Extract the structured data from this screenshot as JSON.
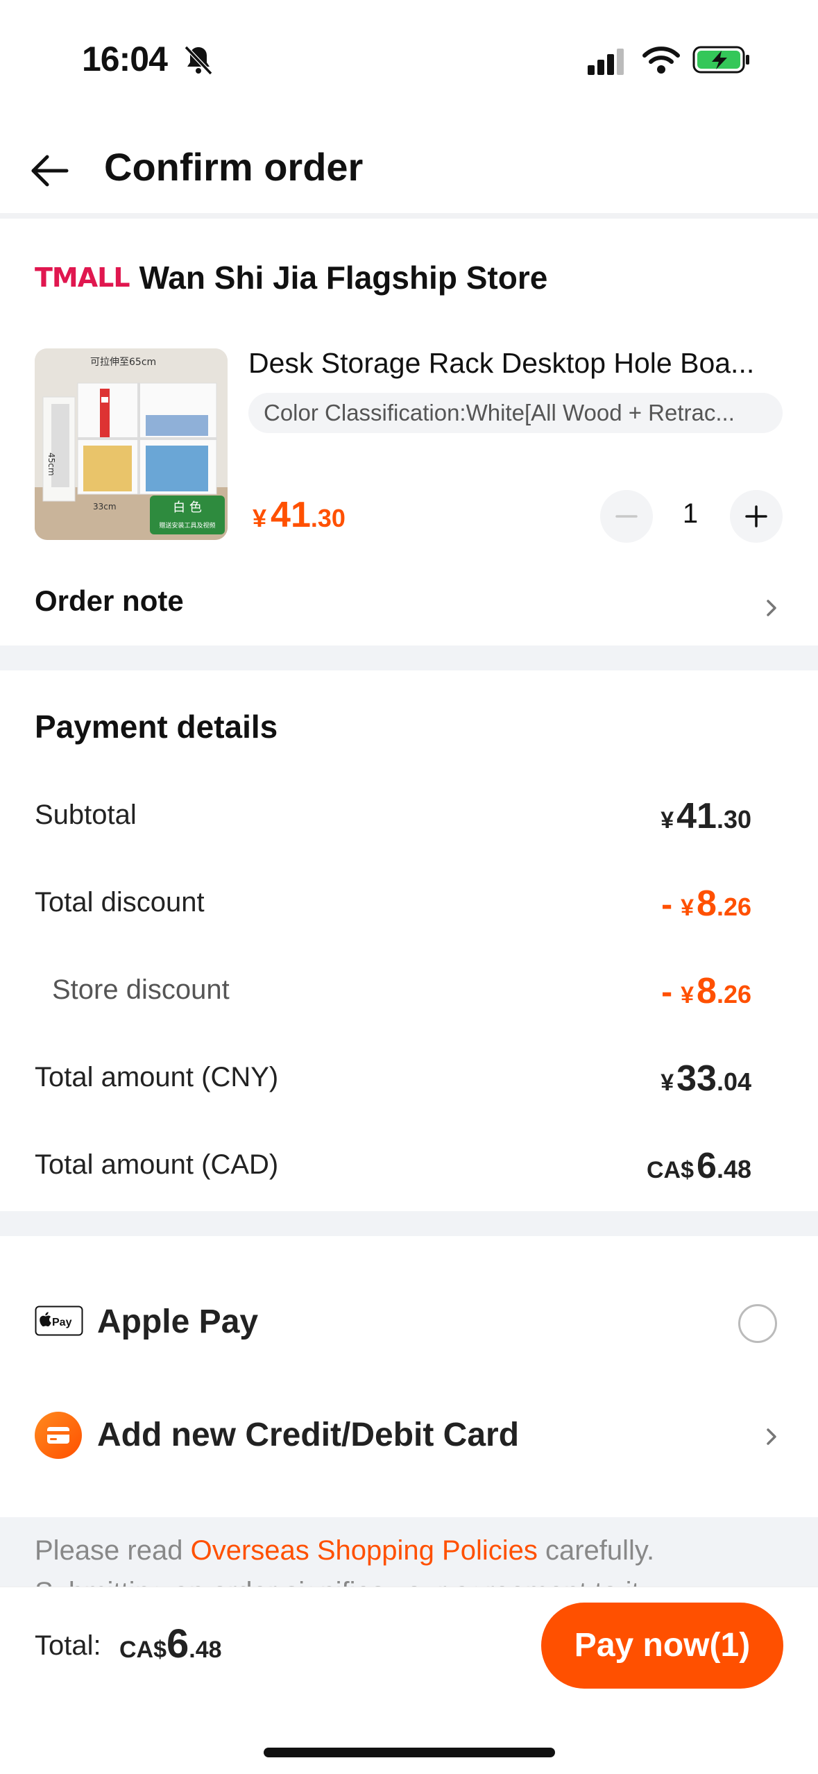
{
  "status_bar": {
    "time": "16:04"
  },
  "header": {
    "title": "Confirm order"
  },
  "store": {
    "logo_text": "TMALL",
    "name": "Wan Shi Jia Flagship Store"
  },
  "product": {
    "image_text_top": "可拉伸至65cm",
    "image_text_left": "45cm",
    "image_text_bottom": "33cm",
    "image_badge_title": "白 色",
    "image_badge_sub": "赠送安装工具及视频",
    "title": "Desk Storage Rack Desktop Hole Boa...",
    "variant": "Color Classification:White[All Wood + Retrac...",
    "price": {
      "currency": "¥",
      "int": "41",
      "dec": ".30"
    },
    "quantity": "1"
  },
  "order_note": {
    "label": "Order note"
  },
  "payment_details": {
    "title": "Payment details",
    "rows": [
      {
        "label": "Subtotal",
        "prefix": "",
        "currency": "¥",
        "int": "41",
        "dec": ".30"
      },
      {
        "label": "Total discount",
        "prefix": "-",
        "currency": "¥",
        "int": "8",
        "dec": ".26"
      },
      {
        "label": "Store discount",
        "prefix": "-",
        "currency": "¥",
        "int": "8",
        "dec": ".26"
      },
      {
        "label": "Total amount (CNY)",
        "prefix": "",
        "currency": "¥",
        "int": "33",
        "dec": ".04"
      },
      {
        "label": "Total amount (CAD)",
        "prefix": "",
        "currency": "CA$",
        "int": "6",
        "dec": ".48"
      }
    ]
  },
  "payment_methods": {
    "apple_pay": {
      "icon_text": "Pay",
      "label": "Apple Pay"
    },
    "card": {
      "label": "Add new Credit/Debit Card"
    }
  },
  "policy": {
    "prefix": "Please read ",
    "link": "Overseas Shopping Policies",
    "suffix": " carefully.",
    "line2": "Submitting an order signifies your agreement to it..."
  },
  "bottom_bar": {
    "total_label": "Total:",
    "total_currency": "CA$",
    "total_int": "6",
    "total_dec": ".48",
    "pay_button": "Pay now(1)"
  },
  "colors": {
    "accent": "#ff5000",
    "tmall": "#e0174f",
    "band": "#f1f3f6"
  }
}
